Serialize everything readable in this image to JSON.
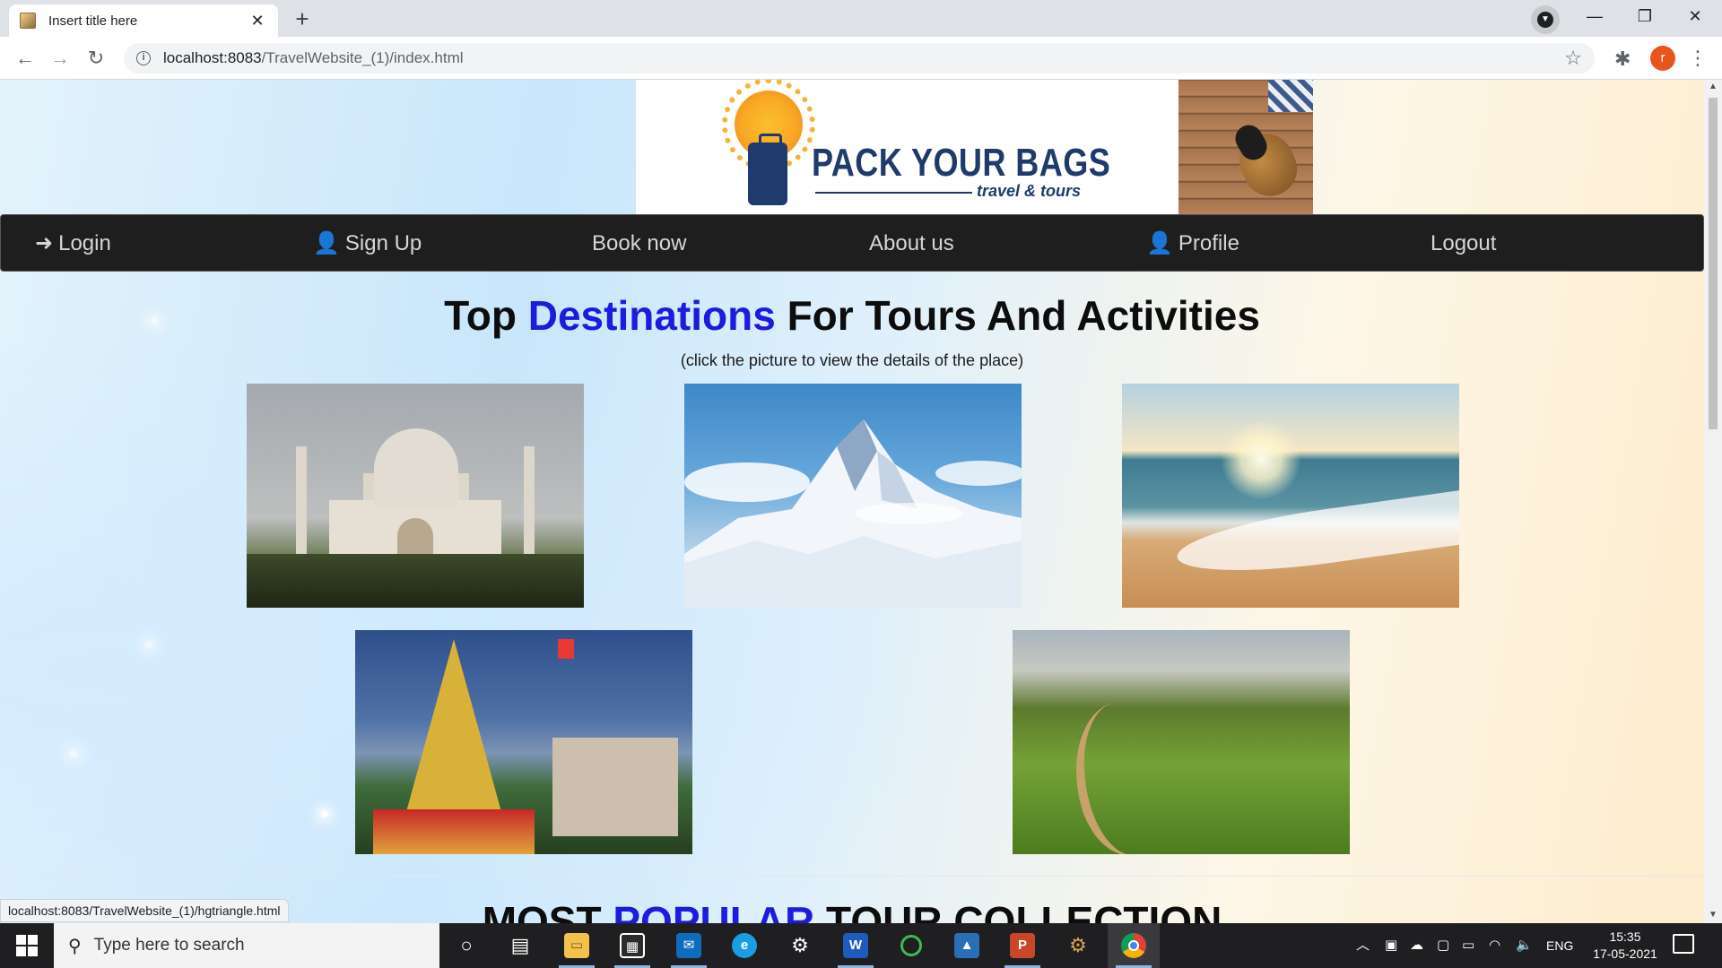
{
  "browser": {
    "tab_title": "Insert title here",
    "tab_close": "✕",
    "new_tab": "+",
    "url_host": "localhost:8083",
    "url_path": "/TravelWebsite_(1)/index.html",
    "profile_initial": "r",
    "status_url": "localhost:8083/TravelWebsite_(1)/hgtriangle.html"
  },
  "banner": {
    "logo_title": "PACK YOUR BAGS",
    "logo_subtitle": "travel & tours"
  },
  "nav": {
    "items": [
      {
        "label": "Login",
        "icon": "sign-in-icon"
      },
      {
        "label": "Sign Up",
        "icon": "user-plus-icon"
      },
      {
        "label": "Book now",
        "icon": ""
      },
      {
        "label": "About us",
        "icon": ""
      },
      {
        "label": "Profile",
        "icon": "user-icon"
      },
      {
        "label": "Logout",
        "icon": ""
      }
    ]
  },
  "section": {
    "heading_pre": "Top ",
    "heading_accent": "Destinations",
    "heading_post": " For Tours And Activities",
    "subtext": "(click the picture to view the details of the place)",
    "destinations": [
      {
        "image": "taj-mahal"
      },
      {
        "image": "snowy-mountain"
      },
      {
        "image": "beach-sunset"
      },
      {
        "image": "golden-temple"
      },
      {
        "image": "tea-plantation"
      }
    ]
  },
  "next_section": {
    "heading_pre": "MOST ",
    "heading_accent": "POPULAR",
    "heading_post": " TOUR COLLECTION"
  },
  "taskbar": {
    "search_placeholder": "Type here to search",
    "language": "ENG",
    "time": "15:35",
    "date": "17-05-2021",
    "apps": [
      "cortana",
      "task-view",
      "file-explorer",
      "microsoft-store",
      "mail",
      "edge",
      "settings",
      "word",
      "spinner-app",
      "photos",
      "powerpoint",
      "gear-app",
      "chrome"
    ]
  },
  "colors": {
    "accent_blue": "#1c1ce0",
    "nav_bg": "#1e1e1e",
    "profile_avatar": "#e8541c"
  }
}
